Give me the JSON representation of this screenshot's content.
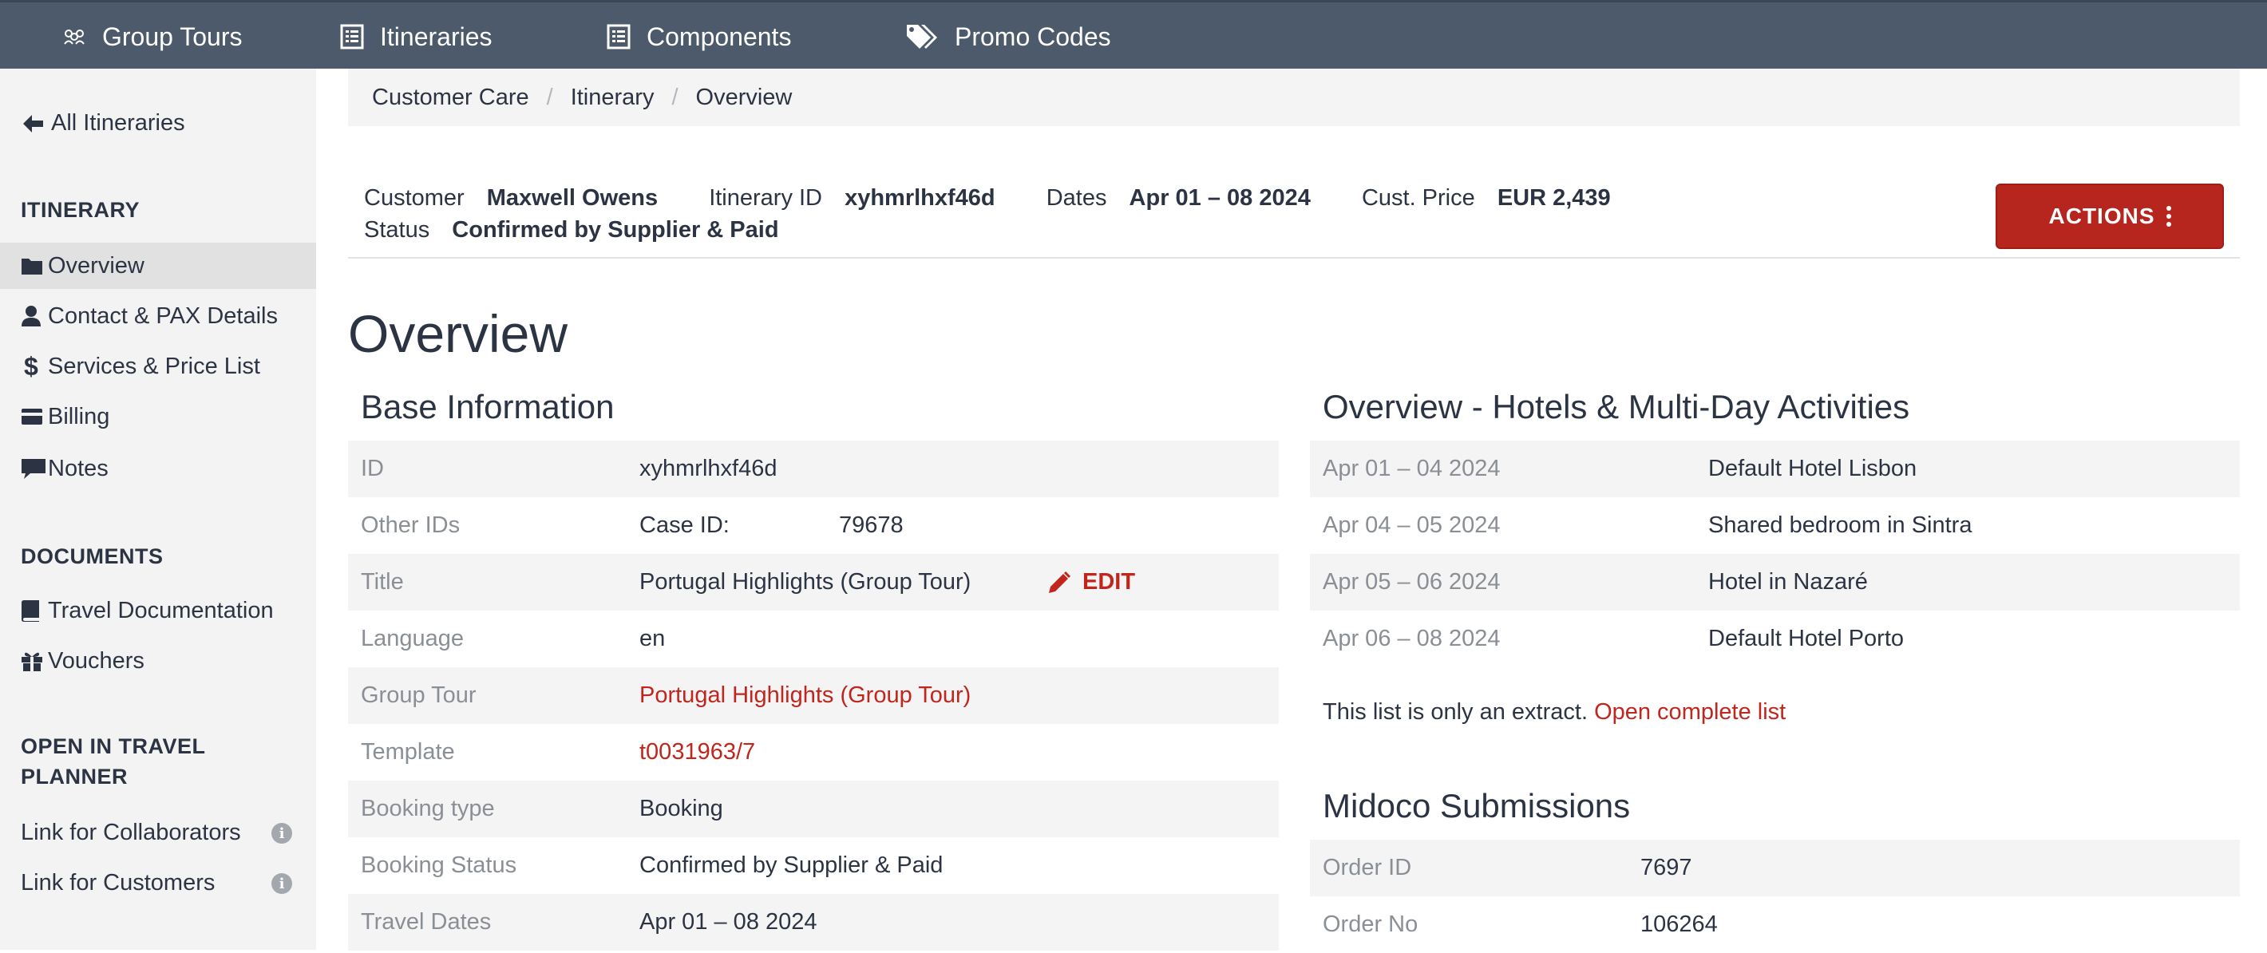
{
  "topnav": {
    "items": [
      {
        "label": "Group Tours",
        "icon": "group-tour-icon"
      },
      {
        "label": "Itineraries",
        "icon": "list-icon"
      },
      {
        "label": "Components",
        "icon": "list-icon"
      },
      {
        "label": "Promo Codes",
        "icon": "tags-icon"
      }
    ]
  },
  "sidebar": {
    "back_label": "All Itineraries",
    "sections": {
      "itinerary": "ITINERARY",
      "documents": "DOCUMENTS",
      "open_in_line1": "OPEN IN TRAVEL",
      "open_in_line2": "PLANNER"
    },
    "itinerary_items": [
      {
        "label": "Overview",
        "icon": "folder-icon",
        "active": true
      },
      {
        "label": "Contact & PAX Details",
        "icon": "user-icon"
      },
      {
        "label": "Services & Price List",
        "icon": "dollar-icon"
      },
      {
        "label": "Billing",
        "icon": "credit-card-icon"
      },
      {
        "label": "Notes",
        "icon": "comment-icon"
      }
    ],
    "document_items": [
      {
        "label": "Travel Documentation",
        "icon": "book-icon"
      },
      {
        "label": "Vouchers",
        "icon": "gift-icon"
      }
    ],
    "planner_items": [
      {
        "label": "Link for Collaborators",
        "icon": "info-icon"
      },
      {
        "label": "Link for Customers",
        "icon": "info-icon"
      }
    ]
  },
  "breadcrumb": [
    "Customer Care",
    "Itinerary",
    "Overview"
  ],
  "infobar": {
    "customer_label": "Customer",
    "customer_value": "Maxwell Owens",
    "itinerary_id_label": "Itinerary ID",
    "itinerary_id_value": "xyhmrlhxf46d",
    "dates_label": "Dates",
    "dates_value": "Apr 01 – 08 2024",
    "price_label": "Cust. Price",
    "price_value": "EUR 2,439",
    "status_label": "Status",
    "status_value": "Confirmed by Supplier & Paid",
    "actions_label": "ACTIONS"
  },
  "page_title": "Overview",
  "base_info": {
    "title": "Base Information",
    "rows": {
      "id": {
        "key": "ID",
        "value": "xyhmrlhxf46d"
      },
      "other_ids": {
        "key": "Other IDs",
        "sub_key": "Case ID:",
        "value": "79678"
      },
      "title": {
        "key": "Title",
        "value": "Portugal Highlights (Group Tour)",
        "edit_label": "EDIT"
      },
      "language": {
        "key": "Language",
        "value": "en"
      },
      "group_tour": {
        "key": "Group Tour",
        "value": "Portugal Highlights (Group Tour)"
      },
      "template": {
        "key": "Template",
        "value": "t0031963/7"
      },
      "booking_type": {
        "key": "Booking type",
        "value": "Booking"
      },
      "booking_status": {
        "key": "Booking Status",
        "value": "Confirmed by Supplier & Paid"
      },
      "travel_dates": {
        "key": "Travel Dates",
        "value": "Apr 01 – 08 2024"
      }
    }
  },
  "hotels": {
    "title": "Overview - Hotels & Multi-Day Activities",
    "rows": [
      {
        "dates": "Apr 01 – 04 2024",
        "name": "Default Hotel Lisbon"
      },
      {
        "dates": "Apr 04 – 05 2024",
        "name": "Shared bedroom in Sintra"
      },
      {
        "dates": "Apr 05 – 06 2024",
        "name": "Hotel in Nazaré"
      },
      {
        "dates": "Apr 06 – 08 2024",
        "name": "Default Hotel Porto"
      }
    ],
    "extract_text": "This list is only an extract.",
    "extract_link": "Open complete list"
  },
  "midoco": {
    "title": "Midoco Submissions",
    "rows": [
      {
        "key": "Order ID",
        "value": "7697"
      },
      {
        "key": "Order No",
        "value": "106264"
      }
    ]
  },
  "colors": {
    "topnav_bg": "#4d5a6c",
    "accent_red": "#b7261e",
    "link_red": "#c0261d",
    "sidebar_bg": "#f3f3f3"
  }
}
